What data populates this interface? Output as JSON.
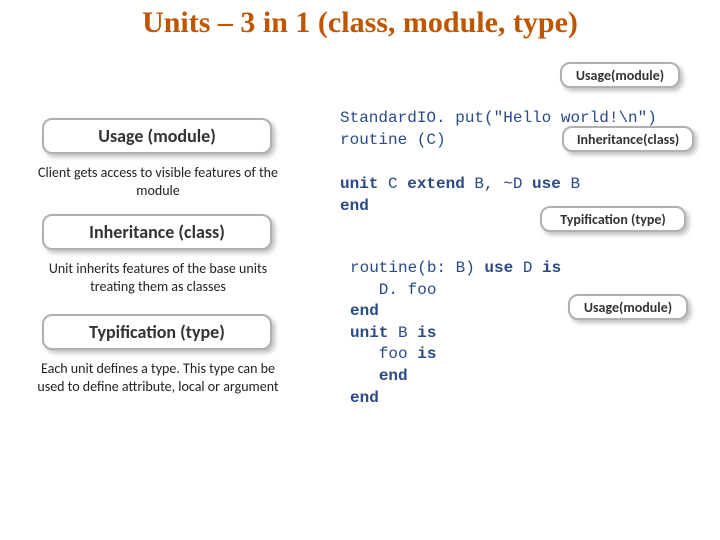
{
  "title": "Units – 3 in 1 (class, module, type)",
  "left": {
    "usage": {
      "heading": "Usage (module)",
      "desc": "Client gets access to visible features of the module"
    },
    "inheritance": {
      "heading": "Inheritance (class)",
      "desc": "Unit inherits features of the base units treating them as classes"
    },
    "typification": {
      "heading": "Typification (type)",
      "desc": "Each unit defines a type. This type can be used to define attribute, local or argument"
    }
  },
  "tags": {
    "t1": "Usage(module)",
    "t2": "Inheritance(class)",
    "t3": "Typification (type)",
    "t4": "Usage(module)"
  },
  "code": {
    "l1a": "Standard",
    "l1b": "IO. put(\"Hello world!\\n\")",
    "l2a": "routine (C)",
    "l3_unit": "unit",
    "l3_mid": " C ",
    "l3_extend": "extend",
    "l3_mid2": " B, ~D ",
    "l3_use": "use",
    "l3_tail": " B",
    "l4_end": "end",
    "l5a": "routine(b: B) ",
    "l5_use": "use",
    "l5b": " D ",
    "l5_is": "is",
    "l6": "   D. foo",
    "l7_end": "end",
    "l8_unit": "unit",
    "l8_mid": " B ",
    "l8_is": "is",
    "l9a": "   foo ",
    "l9_is": "is",
    "l10": "   ",
    "l10_end": "end",
    "l11_end": "end"
  }
}
